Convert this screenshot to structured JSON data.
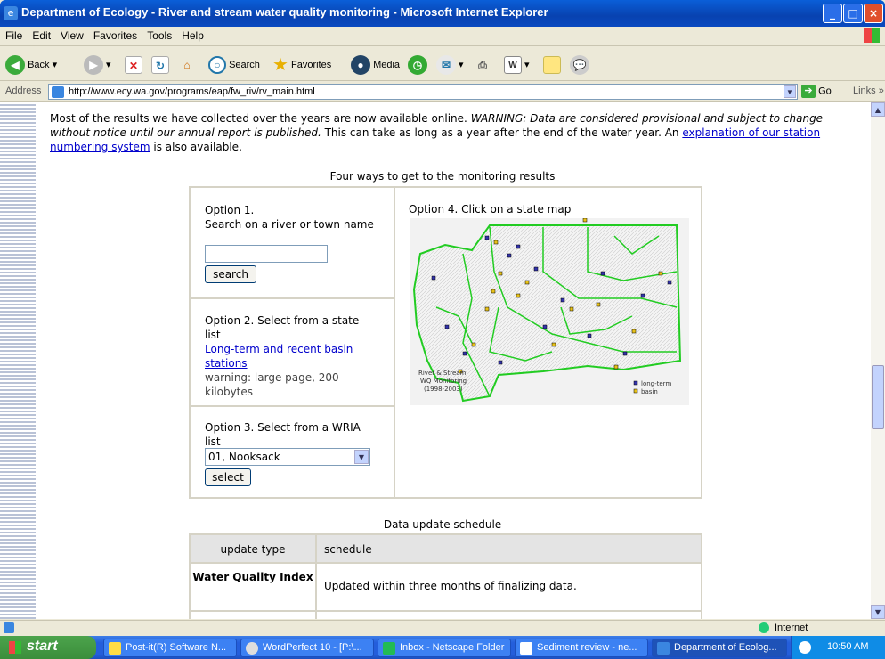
{
  "window": {
    "title": "Department of Ecology - River and stream water quality monitoring - Microsoft Internet Explorer",
    "controls": {
      "minimize": "_",
      "maximize": "□",
      "close": "×"
    }
  },
  "menu": [
    "File",
    "Edit",
    "View",
    "Favorites",
    "Tools",
    "Help"
  ],
  "toolbar": {
    "back": "Back",
    "search": "Search",
    "favorites": "Favorites",
    "media": "Media"
  },
  "address": {
    "label": "Address",
    "url": "http://www.ecy.wa.gov/programs/eap/fw_riv/rv_main.html",
    "go": "Go",
    "links": "Links"
  },
  "page": {
    "intro_part1": "Most of the results we have collected over the years are now available online. ",
    "intro_warning": "WARNING: Data are considered provisional and subject to change without notice until our annual report is published.",
    "intro_part2": " This can take as long as a year after the end of the water year. An ",
    "intro_link": "explanation of our station numbering system",
    "intro_part3": " is also available.",
    "heading": "Four ways to get to the monitoring results",
    "option1": {
      "title_line1": "Option 1.",
      "title_line2": "Search on a river or town name",
      "input_value": "",
      "button": "search"
    },
    "option2": {
      "title": "Option 2. Select from a state list",
      "link": "Long-term and recent basin stations",
      "note": "warning: large page, 200 kilobytes"
    },
    "option3": {
      "title": "Option 3. Select from a WRIA list",
      "selected": "01, Nooksack",
      "button": "select"
    },
    "option4": {
      "title": "Option 4. Click on a state map",
      "map_label_1": "River & Stream",
      "map_label_2": "WQ Monitoring",
      "map_label_3": "(1998-2003)",
      "legend_longterm": "long-term",
      "legend_basin": "basin",
      "colors": {
        "longterm": "#3333aa",
        "basin": "#e8c21a",
        "rivers": "#22cc22"
      }
    },
    "schedule": {
      "heading": "Data update schedule",
      "col1": "update type",
      "col2": "schedule",
      "row1_type": "Water Quality Index",
      "row1_schedule": "Updated within three months of finalizing data."
    }
  },
  "status": {
    "zone": "Internet"
  },
  "taskbar": {
    "start": "start",
    "tasks": [
      "Post-it(R) Software N...",
      "WordPerfect 10 - [P:\\...",
      "Inbox - Netscape Folder",
      "Sediment review - ne...",
      "Department of Ecolog..."
    ],
    "clock": "10:50 AM"
  }
}
